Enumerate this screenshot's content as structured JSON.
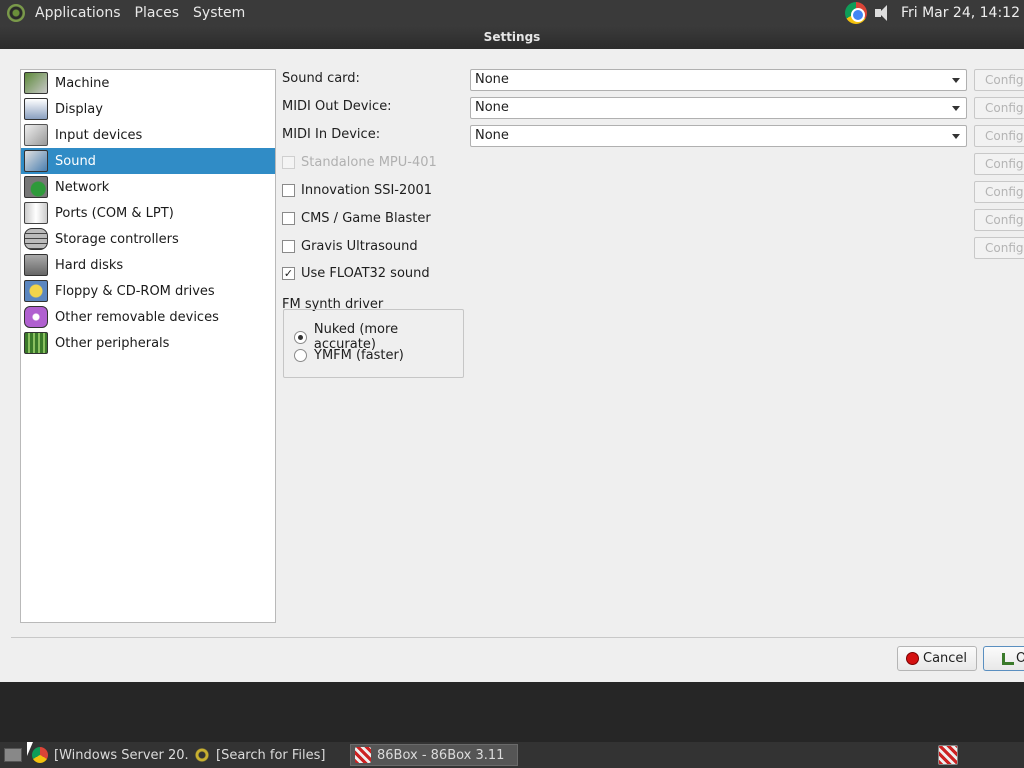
{
  "top_panel": {
    "menus": [
      "Applications",
      "Places",
      "System"
    ],
    "clock": "Fri Mar 24, 14:12"
  },
  "dialog": {
    "title": "Settings",
    "categories": [
      {
        "label": "Machine",
        "icon": "machine-icon"
      },
      {
        "label": "Display",
        "icon": "display-icon"
      },
      {
        "label": "Input devices",
        "icon": "input-devices-icon"
      },
      {
        "label": "Sound",
        "icon": "sound-icon"
      },
      {
        "label": "Network",
        "icon": "network-icon"
      },
      {
        "label": "Ports (COM & LPT)",
        "icon": "ports-icon"
      },
      {
        "label": "Storage controllers",
        "icon": "storage-controllers-icon"
      },
      {
        "label": "Hard disks",
        "icon": "hard-disks-icon"
      },
      {
        "label": "Floppy & CD-ROM drives",
        "icon": "floppy-cdrom-icon"
      },
      {
        "label": "Other removable devices",
        "icon": "removable-devices-icon"
      },
      {
        "label": "Other peripherals",
        "icon": "peripherals-icon"
      }
    ],
    "selected_category": "Sound",
    "sound": {
      "sound_card_label": "Sound card:",
      "sound_card_value": "None",
      "midi_out_label": "MIDI Out Device:",
      "midi_out_value": "None",
      "midi_in_label": "MIDI In Device:",
      "midi_in_value": "None",
      "configure_label": "Configure",
      "checkboxes": [
        {
          "label": "Standalone MPU-401",
          "checked": false,
          "disabled": true
        },
        {
          "label": "Innovation SSI-2001",
          "checked": false,
          "disabled": false
        },
        {
          "label": "CMS / Game Blaster",
          "checked": false,
          "disabled": false
        },
        {
          "label": "Gravis Ultrasound",
          "checked": false,
          "disabled": false
        },
        {
          "label": "Use FLOAT32 sound",
          "checked": true,
          "disabled": false
        }
      ],
      "fm_driver_label": "FM synth driver",
      "fm_options": [
        {
          "label": "Nuked (more accurate)",
          "selected": true
        },
        {
          "label": "YMFM (faster)",
          "selected": false
        }
      ]
    },
    "buttons": {
      "cancel": "Cancel",
      "ok": "OK"
    }
  },
  "taskbar": {
    "tasks": [
      {
        "label": "[Windows Server 20...",
        "icon": "chrome-icon"
      },
      {
        "label": "[Search for Files]",
        "icon": "search-icon"
      },
      {
        "label": "86Box - 86Box 3.11",
        "icon": "86box-icon"
      }
    ]
  },
  "colors": {
    "selection": "#308cc6",
    "panel_bg": "#3a3a3a",
    "dialog_bg": "#efefef"
  }
}
